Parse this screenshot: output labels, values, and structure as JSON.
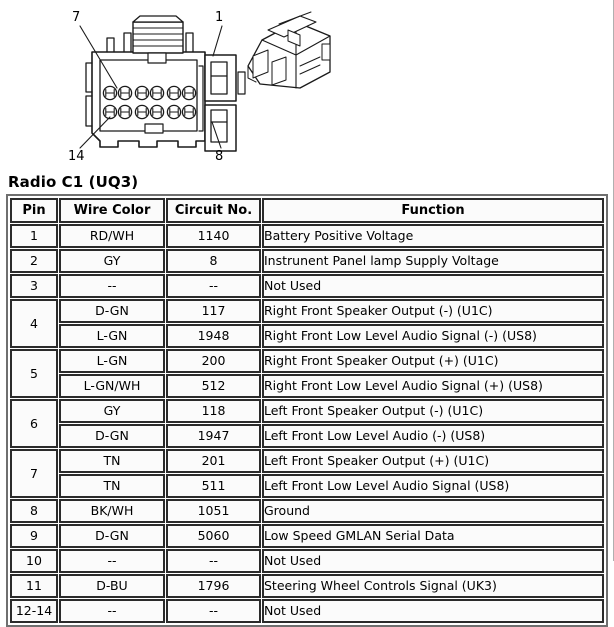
{
  "diagram": {
    "name": "radio-connector-c1-pinout-diagram",
    "callouts": [
      {
        "id": "callout-7",
        "label": "7"
      },
      {
        "id": "callout-1",
        "label": "1"
      },
      {
        "id": "callout-14",
        "label": "14"
      },
      {
        "id": "callout-8",
        "label": "8"
      }
    ],
    "connector_rows": 2,
    "connector_cavities_per_row": 7
  },
  "page": {
    "title": "Radio C1 (UQ3)"
  },
  "table": {
    "headers": {
      "pin": "Pin",
      "wire_color": "Wire Color",
      "circuit_no": "Circuit No.",
      "function": "Function"
    },
    "rows": [
      {
        "pin": "1",
        "pin_span": 1,
        "wire_color": "RD/WH",
        "circuit_no": "1140",
        "function": "Battery Positive Voltage"
      },
      {
        "pin": "2",
        "pin_span": 1,
        "wire_color": "GY",
        "circuit_no": "8",
        "function": "Instrunent Panel lamp Supply Voltage"
      },
      {
        "pin": "3",
        "pin_span": 1,
        "wire_color": "--",
        "circuit_no": "--",
        "function": "Not Used"
      },
      {
        "pin": "4",
        "pin_span": 2,
        "wire_color": "D-GN",
        "circuit_no": "117",
        "function": "Right Front Speaker Output (-) (U1C)"
      },
      {
        "pin": null,
        "pin_span": 0,
        "wire_color": "L-GN",
        "circuit_no": "1948",
        "function": "Right Front Low Level Audio Signal (-) (US8)"
      },
      {
        "pin": "5",
        "pin_span": 2,
        "wire_color": "L-GN",
        "circuit_no": "200",
        "function": "Right Front Speaker Output (+) (U1C)"
      },
      {
        "pin": null,
        "pin_span": 0,
        "wire_color": "L-GN/WH",
        "circuit_no": "512",
        "function": "Right Front Low Level Audio Signal (+) (US8)"
      },
      {
        "pin": "6",
        "pin_span": 2,
        "wire_color": "GY",
        "circuit_no": "118",
        "function": "Left Front Speaker Output (-) (U1C)"
      },
      {
        "pin": null,
        "pin_span": 0,
        "wire_color": "D-GN",
        "circuit_no": "1947",
        "function": "Left Front Low Level Audio (-) (US8)"
      },
      {
        "pin": "7",
        "pin_span": 2,
        "wire_color": "TN",
        "circuit_no": "201",
        "function": "Left Front Speaker Output (+) (U1C)"
      },
      {
        "pin": null,
        "pin_span": 0,
        "wire_color": "TN",
        "circuit_no": "511",
        "function": "Left Front Low Level Audio Signal (US8)"
      },
      {
        "pin": "8",
        "pin_span": 1,
        "wire_color": "BK/WH",
        "circuit_no": "1051",
        "function": "Ground"
      },
      {
        "pin": "9",
        "pin_span": 1,
        "wire_color": "D-GN",
        "circuit_no": "5060",
        "function": "Low Speed GMLAN Serial Data"
      },
      {
        "pin": "10",
        "pin_span": 1,
        "wire_color": "--",
        "circuit_no": "--",
        "function": "Not Used"
      },
      {
        "pin": "11",
        "pin_span": 1,
        "wire_color": "D-BU",
        "circuit_no": "1796",
        "function": "Steering Wheel Controls Signal (UK3)"
      },
      {
        "pin": "12-14",
        "pin_span": 1,
        "wire_color": "--",
        "circuit_no": "--",
        "function": "Not Used"
      }
    ]
  },
  "colors": {
    "page_background": "#ffffff",
    "cell_border": "#2b2b2b",
    "table_outer_border": "#6f6f6f",
    "cell_fill": "#fbfbfb",
    "text": "#000000",
    "diagram_line": "#1a1a1a"
  }
}
